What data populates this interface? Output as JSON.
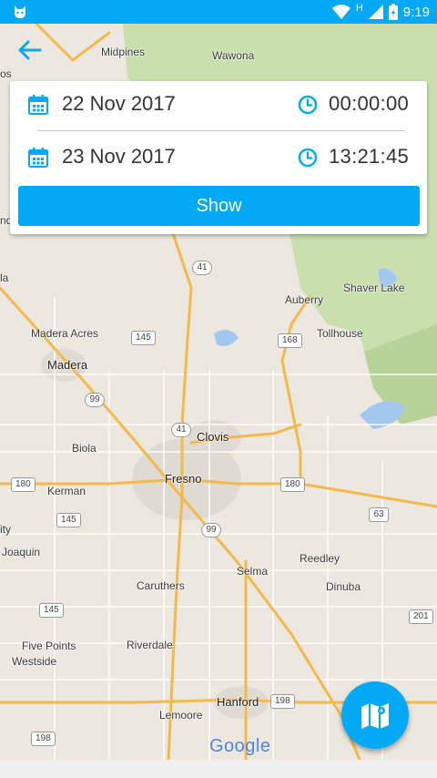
{
  "status_bar": {
    "time": "9:19",
    "network": "H",
    "icons": [
      "android-cat-icon",
      "wifi-icon",
      "signal-icon",
      "battery-charging-icon"
    ]
  },
  "map": {
    "labels": [
      "Midpines",
      "Wawona",
      "Madera Acres",
      "Madera",
      "Auberry",
      "Shaver Lake",
      "Tollhouse",
      "Clovis",
      "Biola",
      "Fresno",
      "Kerman",
      "Reedley",
      "Selma",
      "Dinuba",
      "Caruthers",
      "Riverdale",
      "Five Points",
      "Westside",
      "Hanford",
      "Lemoore",
      "Joaquin",
      "ity",
      "la",
      "os",
      "nd"
    ],
    "shields": [
      "41",
      "145",
      "168",
      "99",
      "41",
      "180",
      "180",
      "145",
      "99",
      "63",
      "145",
      "201",
      "198",
      "198"
    ],
    "attribution": "Google"
  },
  "filter": {
    "start_date": "22 Nov 2017",
    "start_time": "00:00:00",
    "end_date": "23 Nov 2017",
    "end_time": "13:21:45",
    "show_label": "Show"
  },
  "colors": {
    "accent": "#03a9f4",
    "park_green": "#c9dfae",
    "road_orange": "#f3b84e"
  },
  "icons": {
    "back": "arrow-left-icon",
    "calendar": "calendar-icon",
    "clock": "clock-icon",
    "fab": "map-icon"
  }
}
